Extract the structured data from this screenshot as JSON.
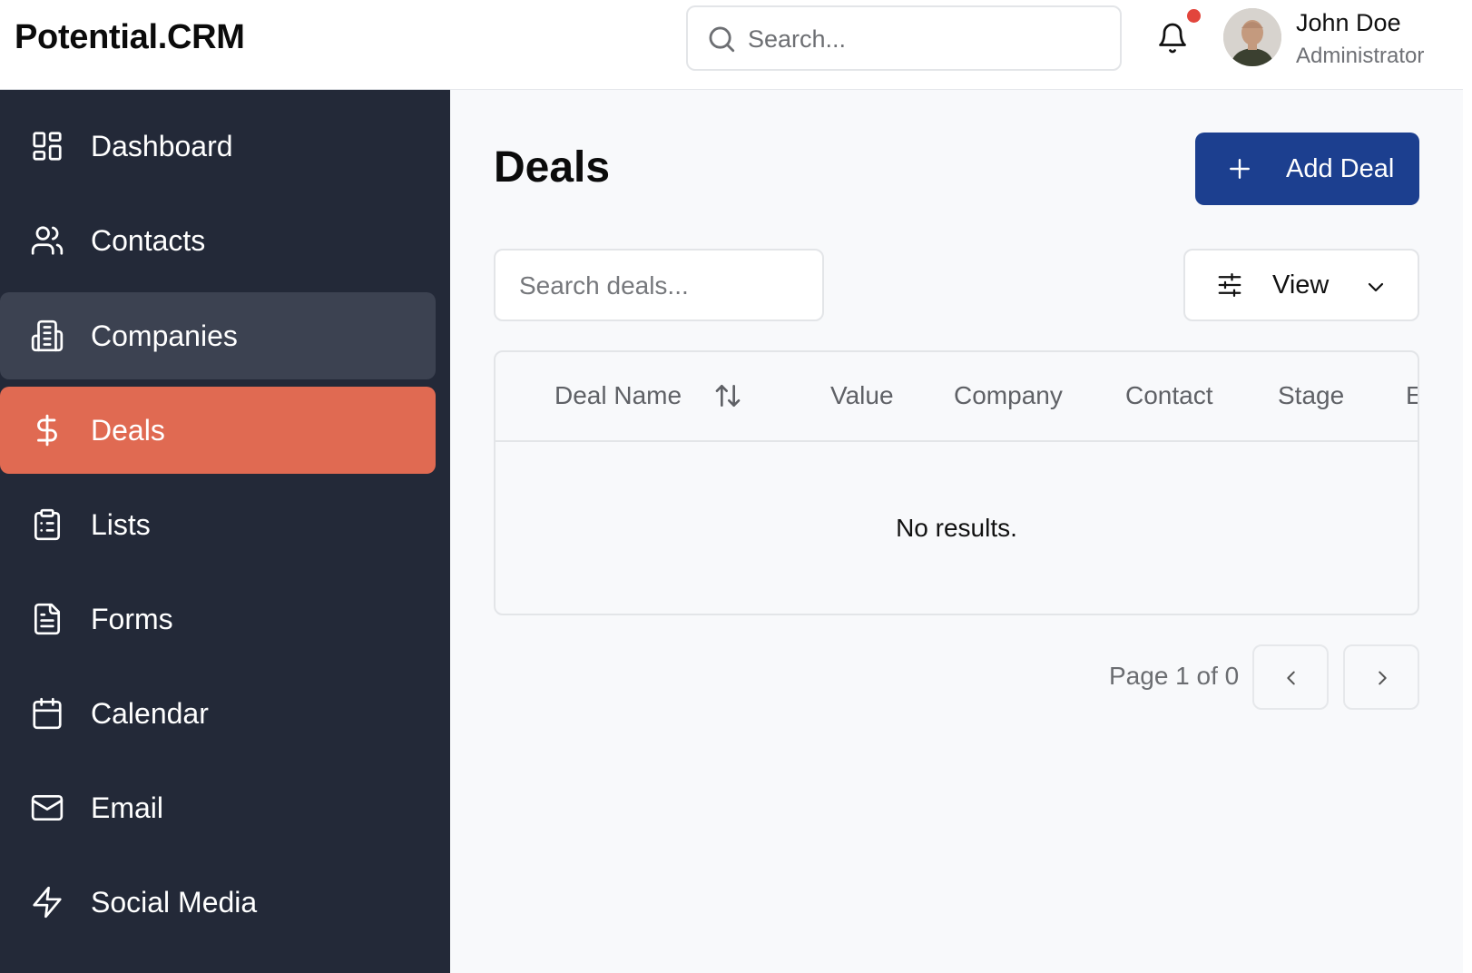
{
  "header": {
    "brand": "Potential.CRM",
    "search_placeholder": "Search...",
    "user": {
      "name": "John Doe",
      "role": "Administrator"
    },
    "notification_badge_color": "#e2453c"
  },
  "sidebar": {
    "items": [
      {
        "label": "Dashboard",
        "icon": "layout-grid-icon",
        "state": "normal"
      },
      {
        "label": "Contacts",
        "icon": "users-icon",
        "state": "normal"
      },
      {
        "label": "Companies",
        "icon": "building-icon",
        "state": "hover"
      },
      {
        "label": "Deals",
        "icon": "dollar-icon",
        "state": "active"
      },
      {
        "label": "Lists",
        "icon": "clipboard-list-icon",
        "state": "normal"
      },
      {
        "label": "Forms",
        "icon": "file-text-icon",
        "state": "normal"
      },
      {
        "label": "Calendar",
        "icon": "calendar-icon",
        "state": "normal"
      },
      {
        "label": "Email",
        "icon": "mail-icon",
        "state": "normal"
      },
      {
        "label": "Social Media",
        "icon": "zap-icon",
        "state": "normal"
      }
    ]
  },
  "main": {
    "title": "Deals",
    "add_button": "Add Deal",
    "search_placeholder": "Search deals...",
    "view_button": "View",
    "table": {
      "columns": [
        "Deal Name",
        "Value",
        "Company",
        "Contact",
        "Stage",
        "E"
      ],
      "empty_message": "No results."
    },
    "pagination": {
      "label": "Page 1 of 0"
    }
  },
  "colors": {
    "sidebar_bg": "#232938",
    "active_item": "#e06a52",
    "hover_item": "#3c4251",
    "primary_button": "#1c3f8f"
  }
}
